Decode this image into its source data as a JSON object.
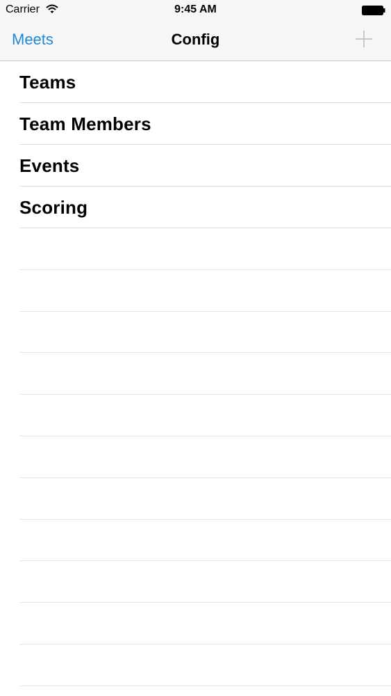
{
  "status_bar": {
    "carrier": "Carrier",
    "time": "9:45 AM",
    "wifi_icon": "wifi-icon",
    "battery_icon": "battery-full-icon"
  },
  "nav_bar": {
    "back_label": "Meets",
    "title": "Config",
    "add_icon": "plus-icon",
    "back_color": "#1f87d3",
    "add_color": "#c7c7cc"
  },
  "menu": {
    "items": [
      {
        "label": "Teams"
      },
      {
        "label": "Team Members"
      },
      {
        "label": "Events"
      },
      {
        "label": "Scoring"
      }
    ]
  }
}
